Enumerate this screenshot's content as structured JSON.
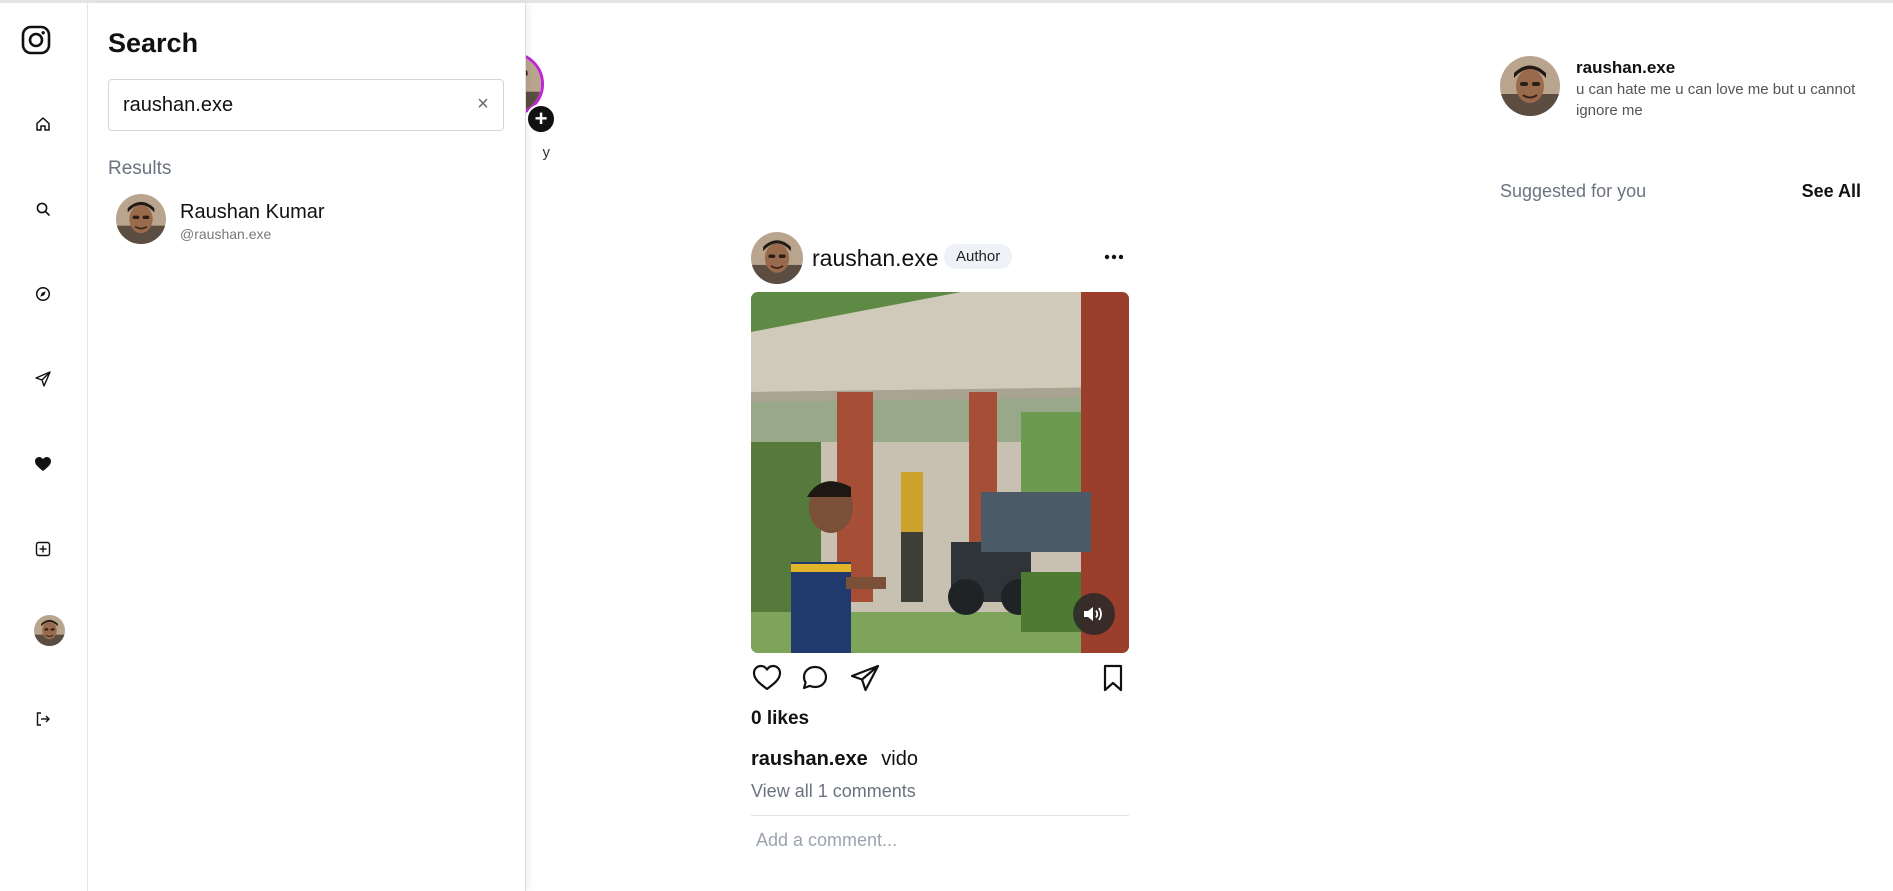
{
  "nav": {
    "items": [
      {
        "name": "instagram-logo-icon"
      },
      {
        "name": "home-icon"
      },
      {
        "name": "search-icon"
      },
      {
        "name": "explore-icon"
      },
      {
        "name": "messages-icon"
      },
      {
        "name": "notifications-icon"
      },
      {
        "name": "create-icon"
      },
      {
        "name": "profile-avatar"
      },
      {
        "name": "logout-icon"
      }
    ]
  },
  "search": {
    "title": "Search",
    "query": "raushan.exe",
    "clear_label": "×",
    "results_label": "Results",
    "results": [
      {
        "name": "Raushan Kumar",
        "handle": "@raushan.exe"
      }
    ]
  },
  "story": {
    "label": "y",
    "add_label": "+"
  },
  "post": {
    "username": "raushan.exe",
    "badge": "Author",
    "likes": "0 likes",
    "caption_user": "raushan.exe",
    "caption_text": "vido",
    "view_comments": "View all 1 comments",
    "comment_placeholder": "Add a comment...",
    "media_type": "video",
    "muted": false
  },
  "sidebar": {
    "username": "raushan.exe",
    "bio": "u can hate me u can love me but u cannot ignore me",
    "suggested_label": "Suggested for you",
    "see_all_label": "See All"
  },
  "colors": {
    "story_ring": "#c026d3",
    "muted_text": "#6b7280",
    "badge_bg": "#eef2f6"
  }
}
